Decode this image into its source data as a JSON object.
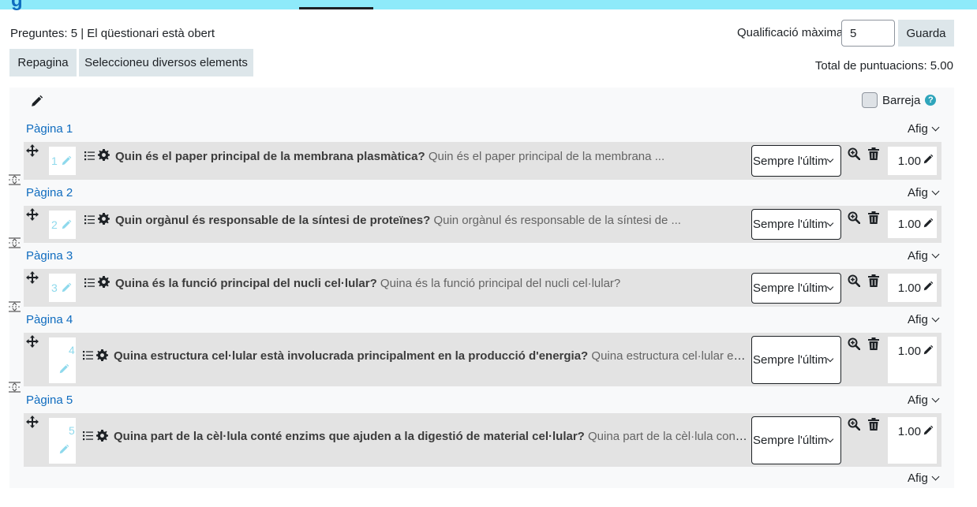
{
  "header": {
    "title_fragment": "g"
  },
  "status_text": "Preguntes: 5 | El qüestionari està obert",
  "max_grade": {
    "label": "Qualificació màxima",
    "value": "5",
    "save_label": "Guarda"
  },
  "toolbar": {
    "repaginate_label": "Repagina",
    "select_multiple_label": "Seleccioneu diversos elements"
  },
  "total_marks": "Total de puntuacions: 5.00",
  "shuffle": {
    "label": "Barreja",
    "help": "?"
  },
  "add_label": "Afig",
  "behaviour_option": "Sempre l'últim",
  "pages": [
    {
      "label": "Pàgina 1",
      "slot": "1",
      "name": "Quin és el paper principal de la membrana plasmàtica?",
      "preview": "Quin és el paper principal de la membrana ...",
      "mark": "1.00"
    },
    {
      "label": "Pàgina 2",
      "slot": "2",
      "name": "Quin orgànul és responsable de la síntesi de proteïnes?",
      "preview": "Quin orgànul és responsable de la síntesi de ...",
      "mark": "1.00"
    },
    {
      "label": "Pàgina 3",
      "slot": "3",
      "name": "Quina és la funció principal del nucli cel·lular?",
      "preview": "Quina és la funció principal del nucli cel·lular?",
      "mark": "1.00"
    },
    {
      "label": "Pàgina 4",
      "slot": "4",
      "name": "Quina estructura cel·lular està involucrada principalment en la producció d'energia?",
      "preview": "Quina estructura cel·lular està involucrada principalment en la producció d'energia?",
      "mark": "1.00"
    },
    {
      "label": "Pàgina 5",
      "slot": "5",
      "name": "Quina part de la cèl·lula conté enzims que ajuden a la digestió de material cel·lular?",
      "preview": "Quina part de la cèl·lula conté enzims que ajuden a la digestió de material cel·lular?",
      "mark": "1.00"
    }
  ]
}
